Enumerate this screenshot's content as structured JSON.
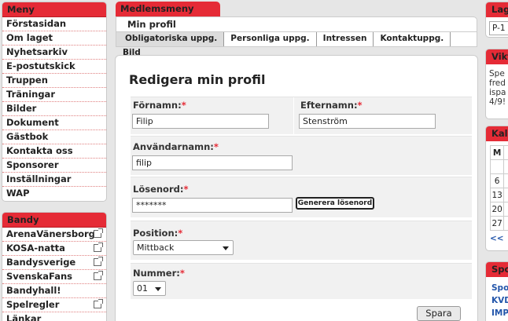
{
  "meny": {
    "header": "Meny",
    "items": [
      "Förstasidan",
      "Om laget",
      "Nyhetsarkiv",
      "E-postutskick",
      "Truppen",
      "Träningar",
      "Bilder",
      "Dokument",
      "Gästbok",
      "Kontakta oss",
      "Sponsorer",
      "Inställningar",
      "WAP"
    ]
  },
  "bandy": {
    "header": "Bandy",
    "items": [
      {
        "label": "ArenaVänersborg",
        "external": true
      },
      {
        "label": "KOSA-natta",
        "external": true
      },
      {
        "label": "Bandysverige",
        "external": true
      },
      {
        "label": "SvenskaFans",
        "external": true
      },
      {
        "label": "Bandyhall!",
        "external": false
      },
      {
        "label": "Spelregler",
        "external": true
      },
      {
        "label": "Länkar",
        "external": false
      }
    ]
  },
  "medlemsmeny": {
    "header": "Medlemsmeny",
    "tab": "Min profil",
    "subtabs": [
      "Obligatoriska uppg.",
      "Personliga uppg.",
      "Intressen",
      "Kontaktuppg.",
      "Bild"
    ],
    "active_subtab": "Obligatoriska uppg."
  },
  "form": {
    "title": "Redigera min profil",
    "required_marker": "*",
    "fornamn": {
      "label": "Förnamn:",
      "value": "Filip"
    },
    "efternamn": {
      "label": "Efternamn:",
      "value": "Stenström"
    },
    "anvandarnamn": {
      "label": "Användarnamn:",
      "value": "filip"
    },
    "losenord": {
      "label": "Lösenord:",
      "value": "*******",
      "generate_button": "Generera lösenord"
    },
    "position": {
      "label": "Position:",
      "value": "Mittback"
    },
    "nummer": {
      "label": "Nummer:",
      "value": "01"
    },
    "save_button": "Spara"
  },
  "right": {
    "lag": {
      "header": "Lag",
      "value": "P-1"
    },
    "vikt": {
      "header": "Vikt",
      "lines": [
        "Spe",
        "fred",
        "ispa",
        "4/9!"
      ]
    },
    "kalender": {
      "header": "Kal",
      "weekday": "M",
      "days": [
        "6",
        "13",
        "20",
        "27"
      ],
      "prev": "<<"
    },
    "spons": {
      "header": "Spo",
      "links": [
        "Spo",
        "KVD",
        "IMP"
      ]
    }
  },
  "colors": {
    "accent": "#e52b36",
    "link": "#2255aa"
  }
}
